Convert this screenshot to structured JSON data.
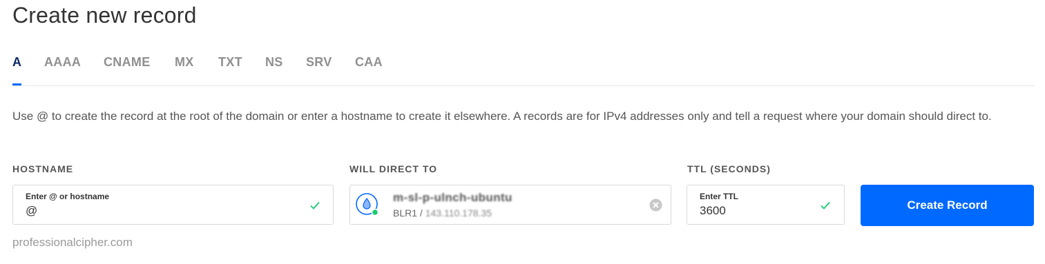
{
  "page": {
    "title": "Create new record"
  },
  "tabs": [
    {
      "label": "A",
      "active": true
    },
    {
      "label": "AAAA"
    },
    {
      "label": "CNAME"
    },
    {
      "label": "MX"
    },
    {
      "label": "TXT"
    },
    {
      "label": "NS"
    },
    {
      "label": "SRV"
    },
    {
      "label": "CAA"
    }
  ],
  "description": "Use @ to create the record at the root of the domain or enter a hostname to create it elsewhere. A records are for IPv4 addresses only and tell a request where your domain should direct to.",
  "hostname": {
    "label": "HOSTNAME",
    "placeholder": "Enter @ or hostname",
    "value": "@",
    "valid_icon": "check-icon"
  },
  "direct_to": {
    "label": "WILL DIRECT TO",
    "resource_name": "m-sl-p-ulnch-ubuntu",
    "region": "BLR1 /",
    "ip": "143.110.178.35",
    "resource_icon": "droplet-icon",
    "status_color": "#15cd72",
    "clear_icon": "clear-icon"
  },
  "ttl": {
    "label": "TTL (SECONDS)",
    "placeholder": "Enter TTL",
    "value": "3600",
    "valid_icon": "check-icon"
  },
  "actions": {
    "create_label": "Create Record"
  },
  "footer": {
    "watermark": "professionalcipher.com"
  },
  "colors": {
    "accent": "#0069ff",
    "active_tab": "#0b2960",
    "valid": "#15cd72"
  }
}
